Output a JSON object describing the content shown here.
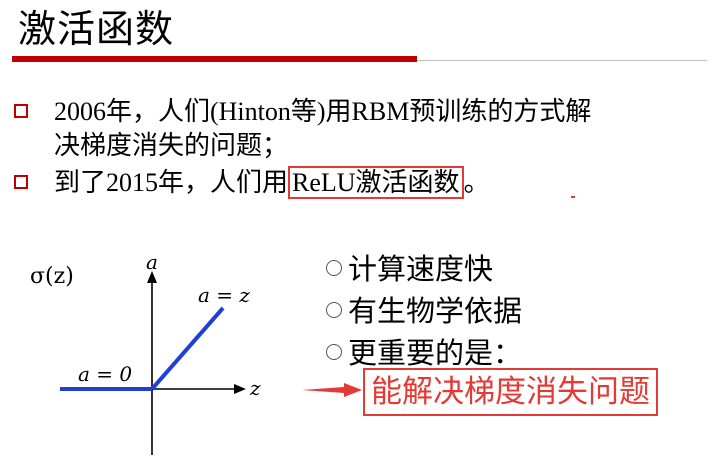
{
  "title": "激活函数",
  "bullets": [
    {
      "line1": "2006年，人们(Hinton等)用RBM预训练的方式解",
      "line2": "决梯度消失的问题；"
    },
    {
      "prefix": "到了2015年，人们用",
      "highlight": "ReLU激活函数",
      "suffix": "。"
    }
  ],
  "figure": {
    "sigma_label": "σ(z)",
    "axis_y": "a",
    "axis_x": "z",
    "left_label": "a = 0",
    "right_label": "a = z",
    "line_color": "#1f3fd6"
  },
  "reasons": [
    "计算速度快",
    "有生物学依据",
    "更重要的是："
  ],
  "answer": "能解决梯度消失问题",
  "colors": {
    "accent": "#c00000",
    "highlight": "#e53935"
  }
}
